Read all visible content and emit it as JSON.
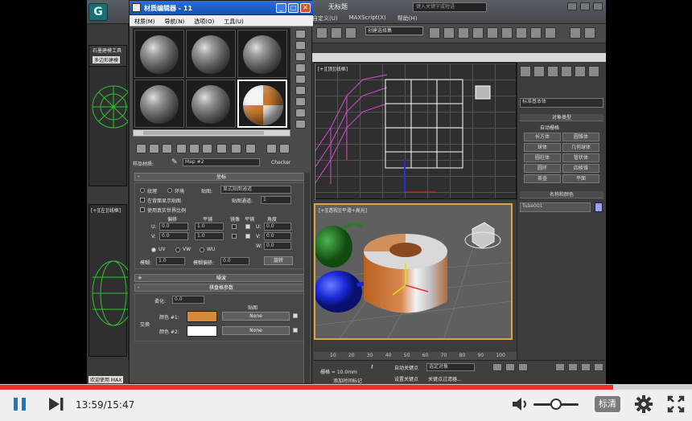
{
  "max_window": {
    "file_title": "无标题",
    "search_placeholder": "键入关键字或短语",
    "menu": [
      "自定义(U)",
      "MAXScript(X)",
      "帮助(H)"
    ],
    "selection_set": "创建选择集",
    "left_labels": [
      "石墨建模工具",
      "多边形建模"
    ],
    "viewport_top_label": "[+][顶][线框]",
    "viewport_persp_label": "[+][透视][平滑+高光]",
    "viewport_left_label": "[+][左][线框]",
    "right_panel": {
      "dropdown": "标准基本体",
      "object_type_header": "对象类型",
      "auto_grid": "自动栅格",
      "buttons": [
        "长方体",
        "圆锥体",
        "球体",
        "几何球体",
        "圆柱体",
        "管状体",
        "圆环",
        "四棱锥",
        "茶壶",
        "平面"
      ],
      "name_color_header": "名称和颜色",
      "object_name": "Tube001",
      "object_color": "#9aa0ff"
    },
    "timeline_ticks": [
      "10",
      "20",
      "30",
      "40",
      "50",
      "60",
      "70",
      "80",
      "90",
      "100"
    ],
    "status": {
      "grid": "栅格 = 10.0mm",
      "auto_key": "自动关键点",
      "selected": "选定对象",
      "set_key": "设置关键点",
      "key_filter": "关键点过滤器...",
      "add_time_tag": "添加时间标记",
      "welcome": "欢迎使用 MAX"
    }
  },
  "material_editor": {
    "title": "材质编辑器 - 11",
    "menu": [
      "材质(M)",
      "导航(N)",
      "选项(O)",
      "工具(U)"
    ],
    "pick_label": "样品材质:",
    "material_name": "Map #2",
    "material_type": "Checker",
    "coordinates": {
      "header": "坐标",
      "texture": "纹理",
      "environ": "环境",
      "mapping_label": "贴图:",
      "mapping_value": "显式贴图通道",
      "show_on_back": "在背面显示贴图",
      "map_channel_label": "贴图通道:",
      "map_channel_value": "1",
      "real_world": "使用真实世界比例",
      "col_offset": "偏移",
      "col_tiling": "平铺",
      "col_mirror": "镜像",
      "col_tile": "平铺",
      "col_angle": "角度",
      "u_label": "U:",
      "v_label": "V:",
      "w_label": "W:",
      "u_offset": "0.0",
      "v_offset": "0.0",
      "u_tiling": "1.0",
      "v_tiling": "1.0",
      "u_angle": "0.0",
      "v_angle": "0.0",
      "w_angle": "0.0",
      "uv": "UV",
      "vw": "VW",
      "wu": "WU",
      "blur_label": "模糊:",
      "blur_value": "1.0",
      "blur_offset_label": "模糊偏移:",
      "blur_offset_value": "0.0",
      "rotate_btn": "旋转"
    },
    "noise_header": "噪波",
    "checker_params": {
      "header": "棋盘格参数",
      "soften_label": "柔化:",
      "soften_value": "0.0",
      "maps_header": "贴图",
      "swap": "交换",
      "color1_label": "颜色 #1:",
      "color2_label": "颜色 #2:",
      "color1": "#d68a3a",
      "color2": "#ffffff",
      "none1": "None",
      "none2": "None"
    }
  },
  "player": {
    "current_time": "13:59",
    "total_time": "15:47",
    "progress": 0.886,
    "volume": 0.5,
    "quality_label": "标清"
  }
}
